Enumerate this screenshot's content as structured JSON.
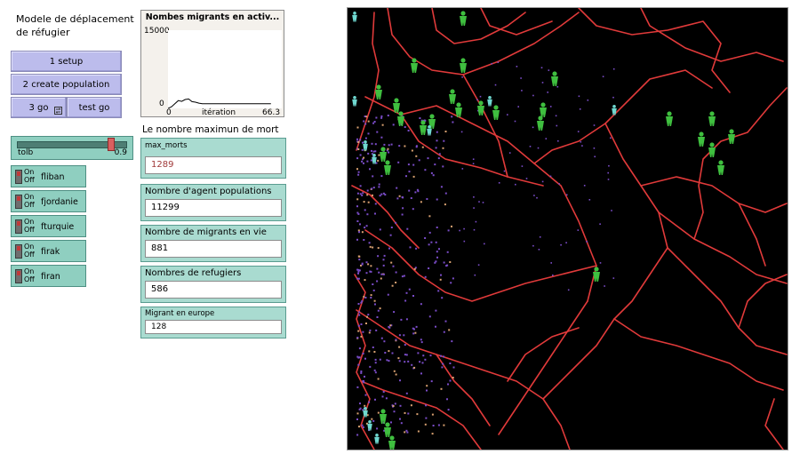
{
  "title_note": {
    "line1": "Modele de déplacement",
    "line2": "de réfugier"
  },
  "buttons": {
    "setup": "1 setup",
    "create_population": "2 create population",
    "go": "3 go",
    "test_go": "test go"
  },
  "plot": {
    "title": "Nombes migrants en activ...",
    "y_max_label": "15000",
    "y_min_label": "0",
    "x_min_label": "0",
    "x_label": "itération",
    "x_max_label": "66.3"
  },
  "chart_data": {
    "type": "line",
    "title": "Nombes migrants en activ...",
    "xlabel": "itération",
    "ylabel": "",
    "xlim": [
      0,
      66.3
    ],
    "ylim": [
      0,
      15000
    ],
    "series": [
      {
        "x": [
          0,
          2,
          4,
          6,
          8,
          10,
          12,
          14,
          16,
          18,
          20,
          25,
          30,
          40,
          50,
          60
        ],
        "values": [
          0,
          300,
          900,
          1500,
          1350,
          1700,
          1800,
          1300,
          1200,
          1000,
          900,
          900,
          900,
          900,
          900,
          900
        ]
      }
    ],
    "colors": {
      "line": "#000000"
    }
  },
  "slider": {
    "name": "tolb",
    "value": "0.9",
    "fraction": 0.9
  },
  "switches": [
    {
      "on": "On",
      "off": "Off",
      "name": "fliban"
    },
    {
      "on": "On",
      "off": "Off",
      "name": "fjordanie"
    },
    {
      "on": "On",
      "off": "Off",
      "name": "fturquie"
    },
    {
      "on": "On",
      "off": "Off",
      "name": "firak"
    },
    {
      "on": "On",
      "off": "Off",
      "name": "firan"
    }
  ],
  "max_note": "Le nombre maximun de mort",
  "input_max_morts": {
    "label": "max_morts",
    "value": "1289"
  },
  "monitors": [
    {
      "label": "Nombre d'agent populations",
      "value": "11299"
    },
    {
      "label": "Nombre de migrants en vie",
      "value": "881"
    },
    {
      "label": "Nombres de refugiers",
      "value": "586"
    },
    {
      "label": "Migrant en europe",
      "value": "128"
    }
  ],
  "colors": {
    "button": "#bcbcec",
    "widget_teal": "#8fcfc0",
    "road": "#e03a3a",
    "agent_green": "#3fbf3f",
    "migrant_purple": "#7a4cc8",
    "refugee_cyan": "#6fd8d0",
    "trail_orange": "#d8a070",
    "world_bg": "#000000"
  }
}
